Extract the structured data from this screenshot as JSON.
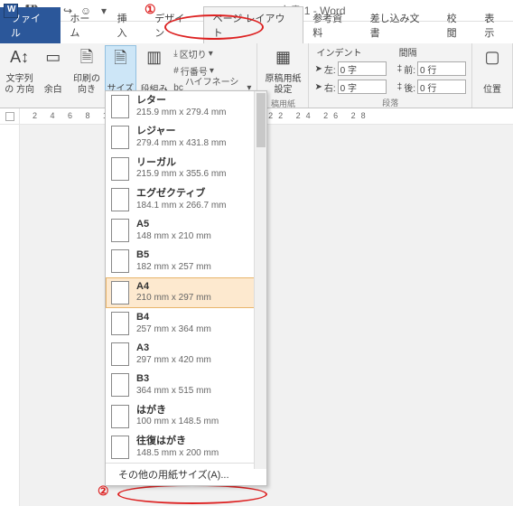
{
  "title": "文書 1 - Word",
  "qat": {
    "save": "💾",
    "undo": "↩",
    "redo": "↪",
    "more": "▾",
    "smile": "☺"
  },
  "tabs": {
    "file": "ファイル",
    "home": "ホーム",
    "insert": "挿入",
    "design": "デザイン",
    "page_layout": "ページ レイアウト",
    "references": "参考資料",
    "mailings": "差し込み文書",
    "review": "校閲",
    "view": "表示"
  },
  "ribbon": {
    "text_direction": "文字列の\n方向",
    "margins": "余白",
    "orientation": "印刷の\n向き",
    "size": "サイズ",
    "columns": "段組み",
    "breaks": "区切り",
    "line_numbers": "行番号",
    "hyphenation": "ハイフネーション",
    "manuscript": "原稿用紙\n設定",
    "manuscript_label": "稿用紙",
    "indent_head": "インデント",
    "spacing_head": "間隔",
    "left_label": "左:",
    "right_label": "右:",
    "before_label": "前:",
    "after_label": "後:",
    "left_val": "0 字",
    "right_val": "0 字",
    "before_val": "0 行",
    "after_val": "0 行",
    "para_label": "段落",
    "position": "位置"
  },
  "ruler_ticks": "2 4 6 8 10 12 14 16 18 20 22 24 26 28",
  "dropdown": {
    "items": [
      {
        "name": "レター",
        "dim": "215.9 mm x 279.4 mm",
        "selected": false
      },
      {
        "name": "レジャー",
        "dim": "279.4 mm x 431.8 mm",
        "selected": false
      },
      {
        "name": "リーガル",
        "dim": "215.9 mm x 355.6 mm",
        "selected": false
      },
      {
        "name": "エグゼクティブ",
        "dim": "184.1 mm x 266.7 mm",
        "selected": false
      },
      {
        "name": "A5",
        "dim": "148 mm x 210 mm",
        "selected": false
      },
      {
        "name": "B5",
        "dim": "182 mm x 257 mm",
        "selected": false
      },
      {
        "name": "A4",
        "dim": "210 mm x 297 mm",
        "selected": true
      },
      {
        "name": "B4",
        "dim": "257 mm x 364 mm",
        "selected": false
      },
      {
        "name": "A3",
        "dim": "297 mm x 420 mm",
        "selected": false
      },
      {
        "name": "B3",
        "dim": "364 mm x 515 mm",
        "selected": false
      },
      {
        "name": "はがき",
        "dim": "100 mm x 148.5 mm",
        "selected": false
      },
      {
        "name": "往復はがき",
        "dim": "148.5 mm x 200 mm",
        "selected": false
      }
    ],
    "footer": "その他の用紙サイズ(A)..."
  },
  "annotations": {
    "one": "①",
    "two": "②"
  }
}
